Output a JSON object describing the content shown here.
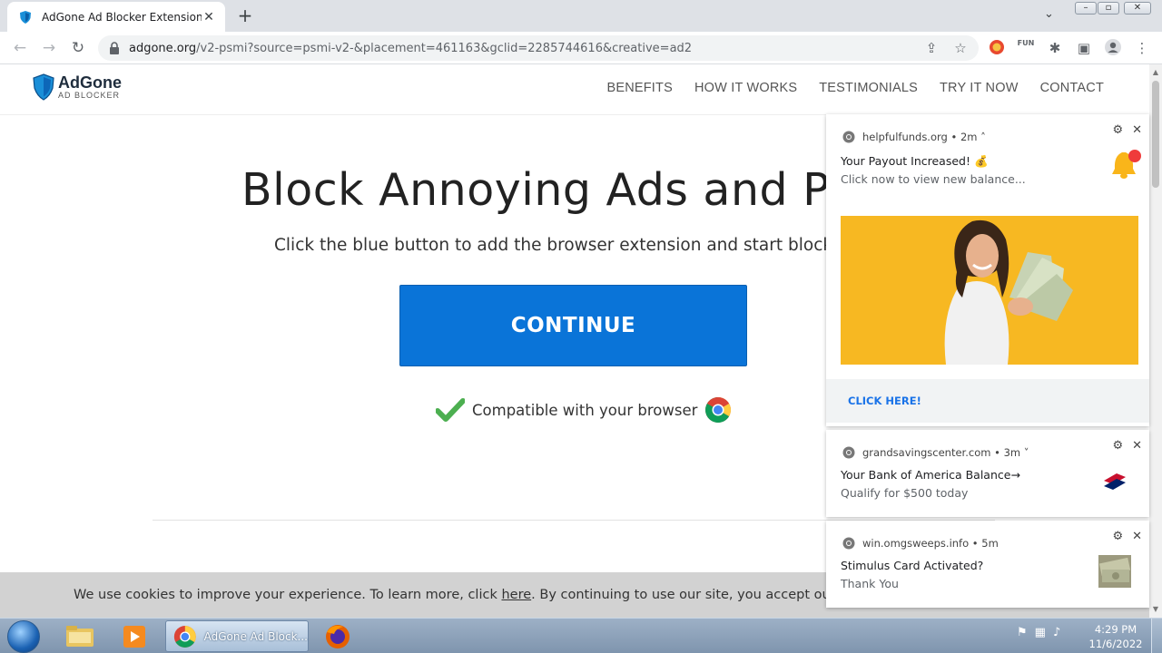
{
  "browser": {
    "tab_title": "AdGone Ad Blocker Extension",
    "tab_close": "✕",
    "new_tab": "+",
    "url_host": "adgone.org",
    "url_rest": "/v2-psmi?source=psmi-v2-&placement=461163&gclid=2285744616&creative=ad2",
    "ext_fun": "FUN"
  },
  "site": {
    "logo_name": "AdGone",
    "logo_sub": "AD BLOCKER",
    "nav": [
      "BENEFITS",
      "HOW IT WORKS",
      "TESTIMONIALS",
      "TRY IT NOW",
      "CONTACT"
    ],
    "hero_title": "Block Annoying Ads and Pop-",
    "hero_sub": "Click the blue button to add the browser extension and start blockir",
    "cta": "CONTINUE",
    "compat": "Compatible with your browser",
    "cookie_before": "We use cookies to improve your experience. To learn more, click ",
    "cookie_link": "here",
    "cookie_after": ". By continuing to use our site, you accept our use of co"
  },
  "notifications": [
    {
      "site": "helpfulfunds.org",
      "age": "2m",
      "title": "Your Payout Increased! 💰",
      "body": "Click now to view new balance...",
      "action": "CLICK HERE!"
    },
    {
      "site": "grandsavingscenter.com",
      "age": "3m",
      "title": " Your Bank of America Balance→",
      "body": "Qualify for $500 today"
    },
    {
      "site": "win.omgsweeps.info",
      "age": "5m",
      "title": "Stimulus Card Activated?",
      "body": "Thank You"
    }
  ],
  "taskbar": {
    "active_label": "AdGone Ad Block...",
    "time": "4:29 PM",
    "date": "11/6/2022"
  },
  "colors": {
    "cta_blue": "#0a74d8",
    "notif_image_bg": "#f7b822",
    "link_blue": "#1a73e8"
  }
}
